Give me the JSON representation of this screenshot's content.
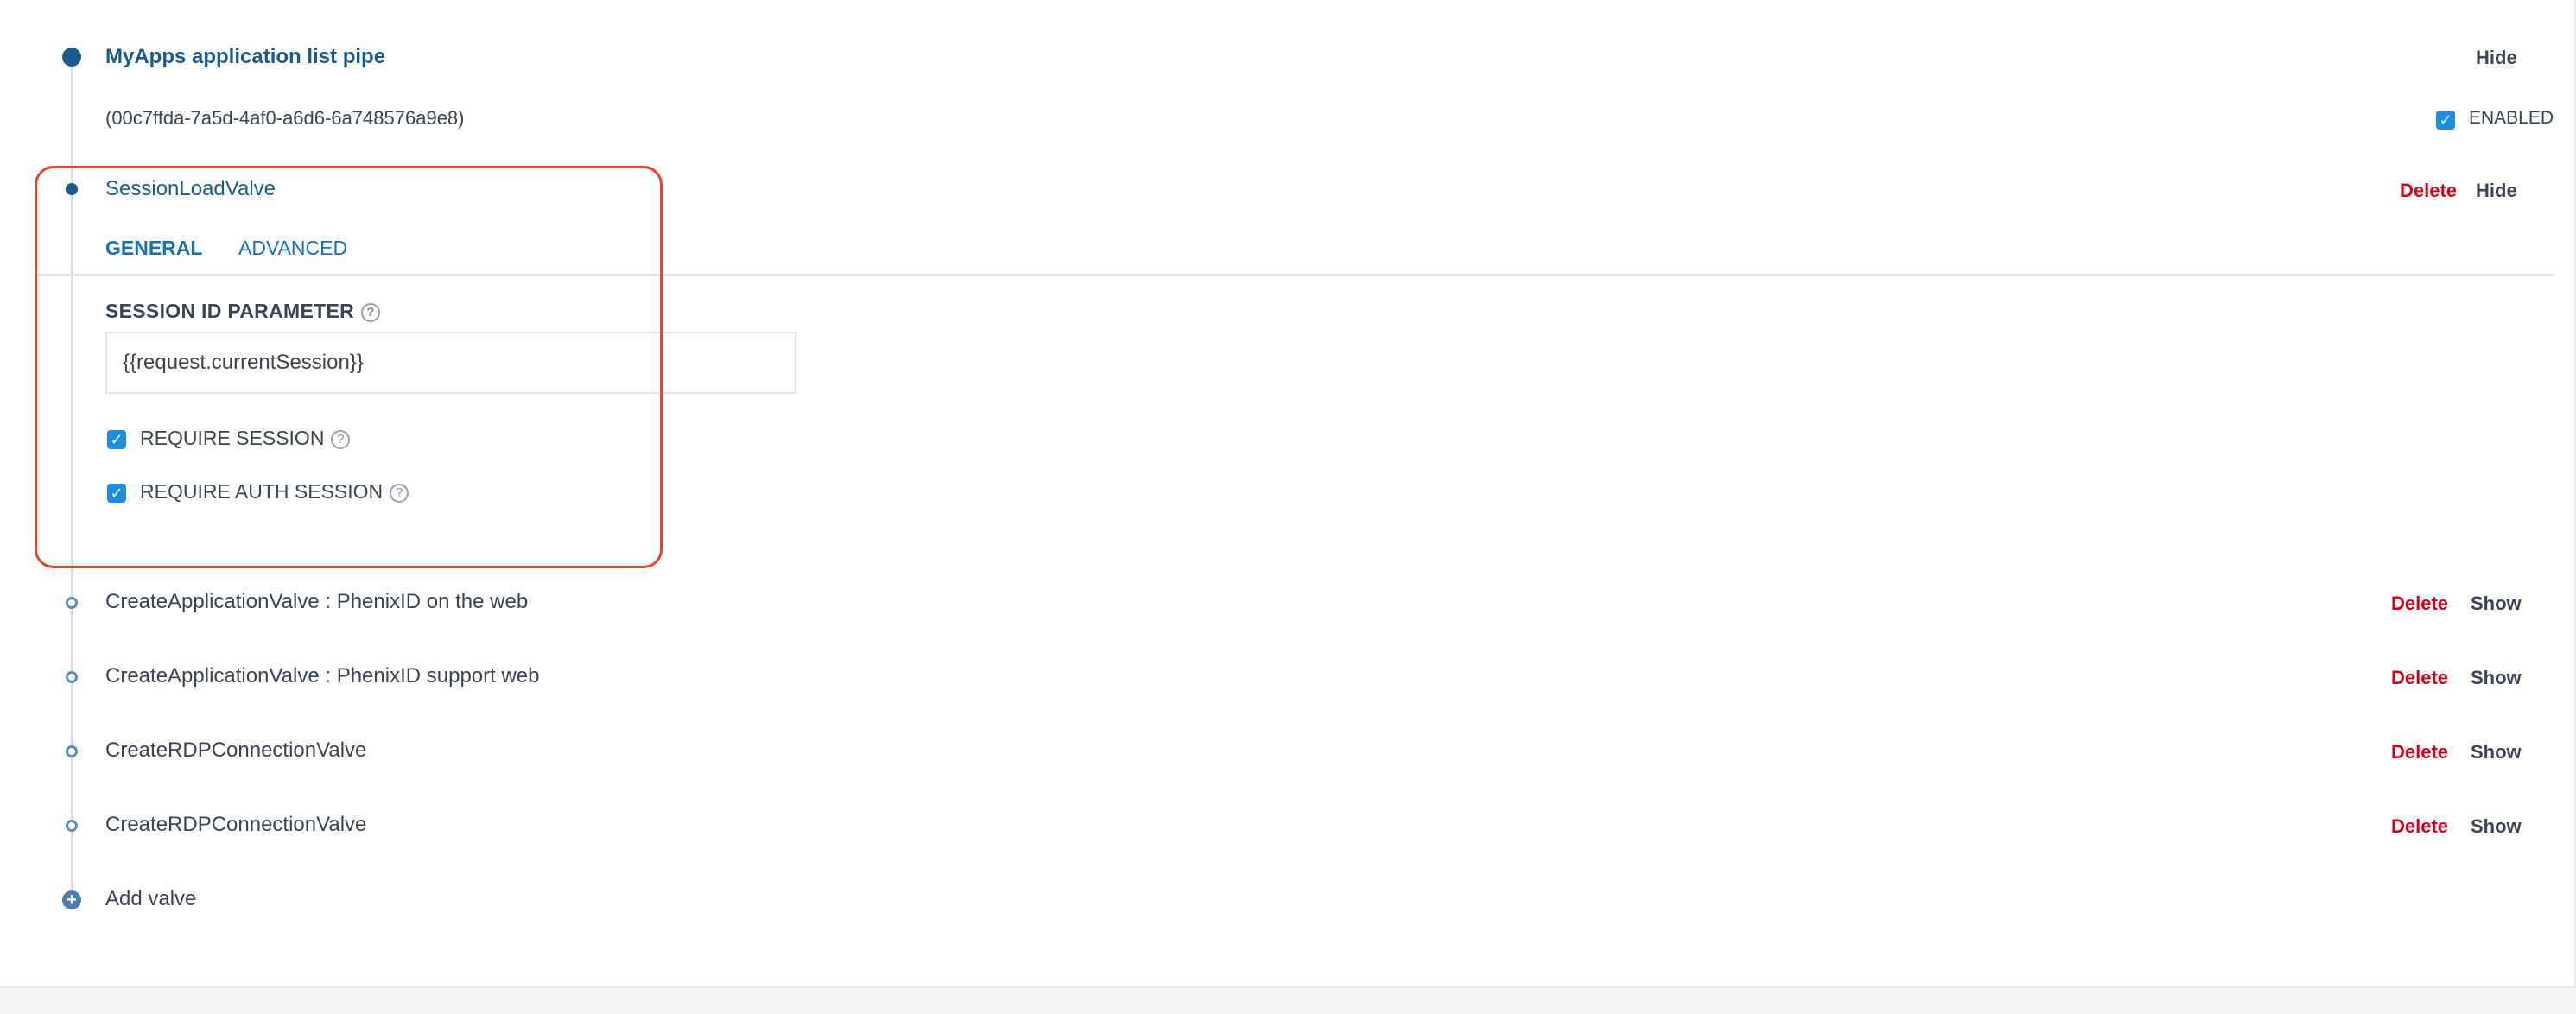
{
  "pipe": {
    "title": "MyApps application list pipe",
    "id": "(00c7ffda-7a5d-4af0-a6d6-6a748576a9e8)",
    "hide_label": "Hide",
    "enabled_label": "ENABLED",
    "enabled": true
  },
  "selected_valve": {
    "name": "SessionLoadValve",
    "delete_label": "Delete",
    "hide_label": "Hide",
    "tabs": [
      {
        "label": "GENERAL",
        "active": true
      },
      {
        "label": "ADVANCED",
        "active": false
      }
    ],
    "session_id_param": {
      "label": "SESSION ID PARAMETER",
      "value": "{{request.currentSession}}"
    },
    "require_session": {
      "label": "REQUIRE SESSION",
      "checked": true
    },
    "require_auth_session": {
      "label": "REQUIRE AUTH SESSION",
      "checked": true
    },
    "help_glyph": "?"
  },
  "valves": [
    {
      "name": "CreateApplicationValve : PhenixID on the web",
      "delete_label": "Delete",
      "show_label": "Show"
    },
    {
      "name": "CreateApplicationValve : PhenixID support web",
      "delete_label": "Delete",
      "show_label": "Show"
    },
    {
      "name": "CreateRDPConnectionValve",
      "delete_label": "Delete",
      "show_label": "Show"
    },
    {
      "name": "CreateRDPConnectionValve",
      "delete_label": "Delete",
      "show_label": "Show"
    }
  ],
  "add_valve_label": "Add valve",
  "colors": {
    "primary": "#1b5a8d",
    "delete": "#d0021b",
    "highlight": "#e8462c",
    "checkbox": "#1e8de0"
  }
}
